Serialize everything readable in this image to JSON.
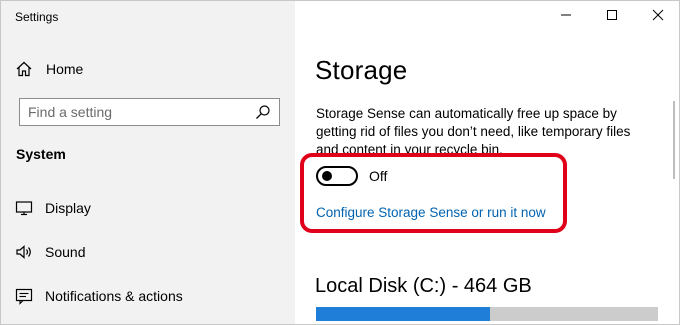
{
  "window": {
    "app_title": "Settings",
    "controls": {
      "minimize": "minimize-icon",
      "maximize": "maximize-icon",
      "close": "close-icon"
    }
  },
  "sidebar": {
    "home_label": "Home",
    "search_placeholder": "Find a setting",
    "section_title": "System",
    "items": [
      {
        "label": "Display",
        "icon": "display-icon"
      },
      {
        "label": "Sound",
        "icon": "speaker-icon"
      },
      {
        "label": "Notifications & actions",
        "icon": "notification-icon"
      }
    ]
  },
  "main": {
    "title": "Storage",
    "description": "Storage Sense can automatically free up space by getting rid of files you don’t need, like temporary files and content in your recycle bin.",
    "toggle_state": "Off",
    "configure_link": "Configure Storage Sense or run it now",
    "disk_title": "Local Disk (C:) - 464 GB",
    "disk_used_fraction": 0.51
  },
  "colors": {
    "accent": "#0063b1",
    "highlight": "#e0001a",
    "disk_fill": "#1f7fd8",
    "sidebar_bg": "#f2f2f2"
  }
}
